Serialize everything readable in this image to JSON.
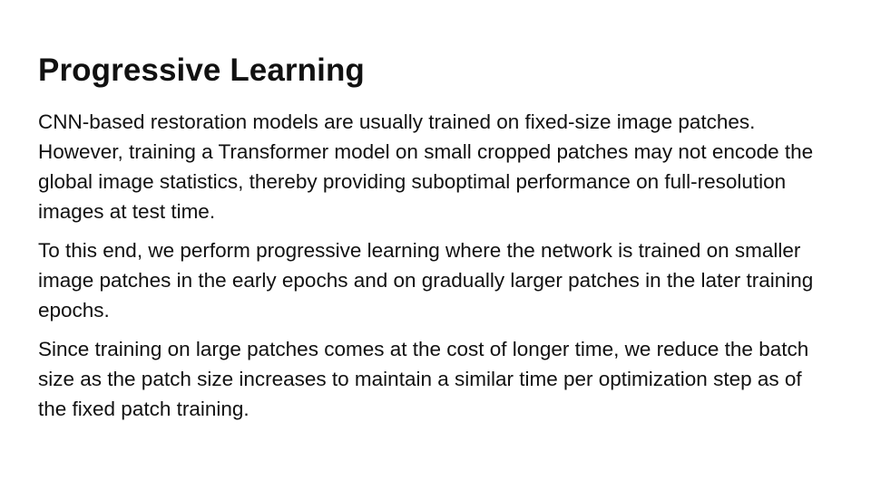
{
  "slide": {
    "title": "Progressive Learning",
    "paragraphs": [
      "CNN-based restoration models are usually trained on fixed-size image patches. However, training a Transformer model on small cropped patches may not encode the global image statistics, thereby providing suboptimal performance on full-resolution images at test time.",
      "To this end, we perform progressive learning where the network is trained on smaller image patches in the early epochs and on gradually larger patches in the later training epochs.",
      "Since training on large patches comes at the cost of longer time, we reduce the batch size as the patch size increases to maintain a similar time per optimization step as of the fixed patch training."
    ]
  }
}
